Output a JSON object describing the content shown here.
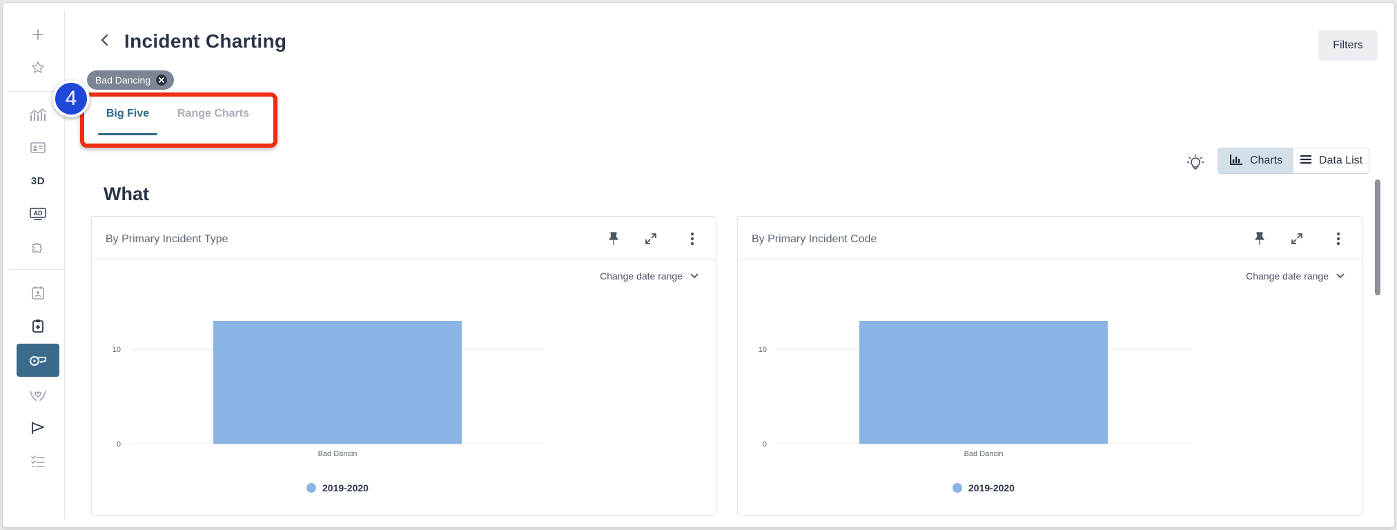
{
  "page": {
    "title": "Incident Charting",
    "filters_label": "Filters",
    "filter_chip": "Bad Dancing",
    "step_number": "4",
    "section_title": "What"
  },
  "tabs": [
    {
      "label": "Big Five",
      "active": true
    },
    {
      "label": "Range Charts",
      "active": false
    }
  ],
  "view_toggle": {
    "charts_label": "Charts",
    "data_list_label": "Data List"
  },
  "sidebar": {
    "items": [
      {
        "icon": "plus-icon"
      },
      {
        "icon": "star-icon"
      },
      {
        "icon": "analytics-icon"
      },
      {
        "icon": "id-card-icon"
      },
      {
        "text": "3D"
      },
      {
        "icon": "ad-badge-icon"
      },
      {
        "icon": "puzzle-icon"
      },
      {
        "icon": "calendar-person-icon"
      },
      {
        "icon": "clipboard-icon"
      },
      {
        "icon": "whistle-icon",
        "active": true
      },
      {
        "icon": "hands-heart-icon"
      },
      {
        "icon": "flag-icon"
      },
      {
        "icon": "checklist-icon"
      }
    ]
  },
  "colors": {
    "accent": "#2f6689",
    "bar": "#8ab4e3",
    "highlight": "#f02d12",
    "badge": "#1f47d8",
    "sidebar_active": "#3a6b8c"
  },
  "cards": [
    {
      "title": "By Primary Incident Type",
      "date_range_label": "Change date range"
    },
    {
      "title": "By Primary Incident Code",
      "date_range_label": "Change date range"
    }
  ],
  "chart_data": [
    {
      "type": "bar",
      "title": "By Primary Incident Type",
      "categories": [
        "Bad Dancin"
      ],
      "series": [
        {
          "name": "2019-2020",
          "values": [
            13
          ]
        }
      ],
      "yticks": [
        0,
        10
      ],
      "ylim": [
        0,
        13
      ],
      "grid": true,
      "legend": "bottom"
    },
    {
      "type": "bar",
      "title": "By Primary Incident Code",
      "categories": [
        "Bad Dancin"
      ],
      "series": [
        {
          "name": "2019-2020",
          "values": [
            13
          ]
        }
      ],
      "yticks": [
        0,
        10
      ],
      "ylim": [
        0,
        13
      ],
      "grid": true,
      "legend": "bottom"
    }
  ]
}
